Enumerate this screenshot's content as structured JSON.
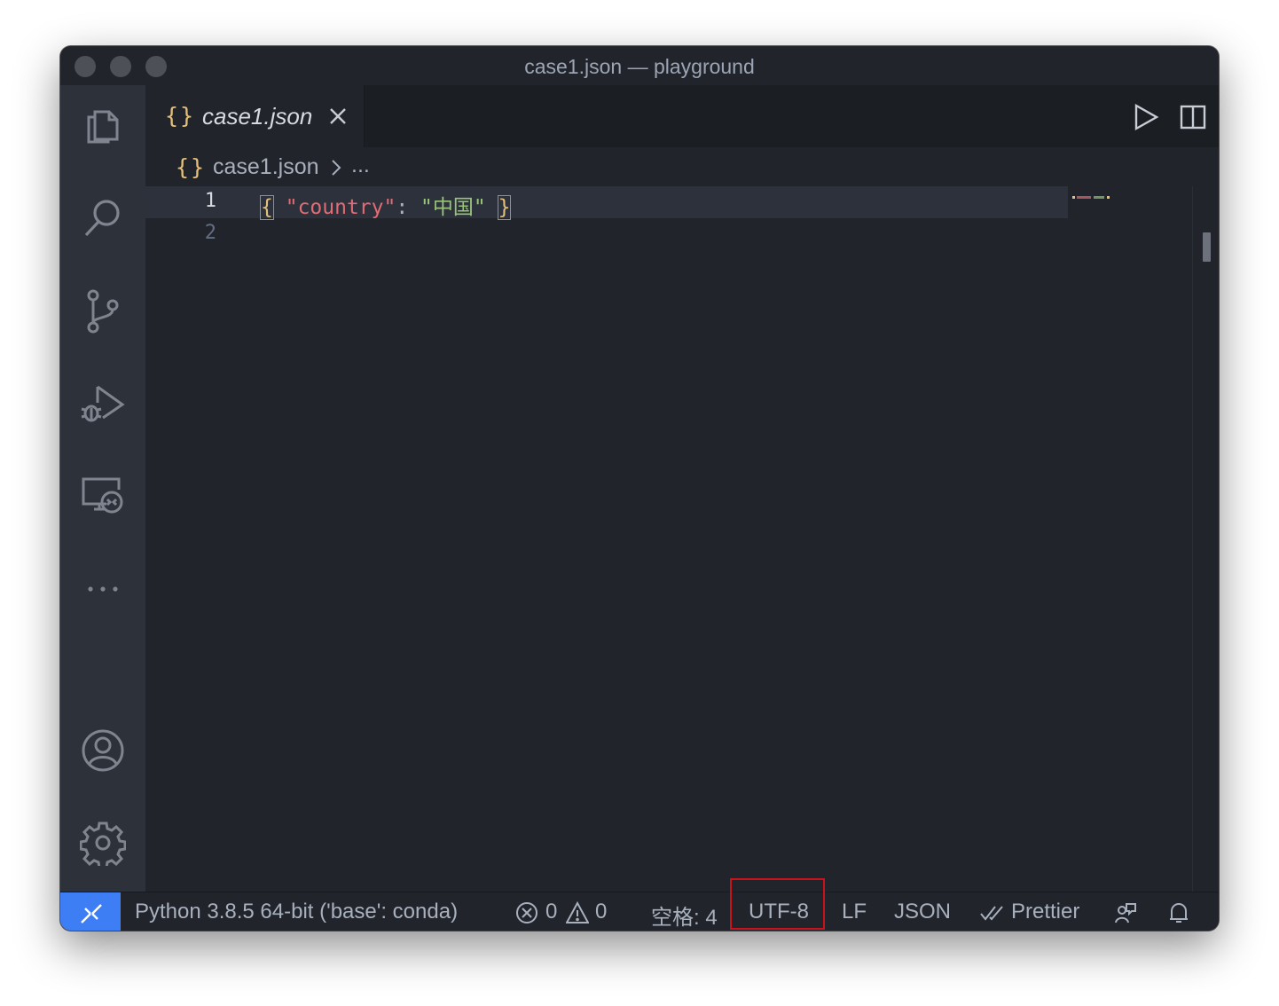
{
  "window": {
    "title": "case1.json — playground"
  },
  "tab": {
    "icon_text": "{}",
    "label": "case1.json"
  },
  "breadcrumb": {
    "icon_text": "{}",
    "file": "case1.json",
    "more": "..."
  },
  "editor": {
    "line_numbers": [
      "1",
      "2"
    ],
    "line1": {
      "open_brace": "{",
      "key": "\"country\"",
      "colon": ": ",
      "value": "\"中国\"",
      "close_brace": "}"
    }
  },
  "status": {
    "python": "Python 3.8.5 64-bit ('base': conda)",
    "errors": "0",
    "warnings": "0",
    "indent": "空格: 4",
    "encoding": "UTF-8",
    "eol": "LF",
    "language": "JSON",
    "prettier": "Prettier"
  },
  "colors": {
    "accent": "#3d7ef5",
    "highlight_box": "#c8121c",
    "json_key": "#e06c75",
    "json_string": "#98c379",
    "brace": "#e5c07b"
  },
  "icons": {
    "activity": [
      "files-icon",
      "search-icon",
      "source-control-icon",
      "run-debug-icon",
      "remote-explorer-icon",
      "more-icon",
      "account-icon",
      "gear-icon"
    ],
    "editor_actions": [
      "run-icon",
      "split-editor-icon",
      "more-actions-icon"
    ]
  }
}
